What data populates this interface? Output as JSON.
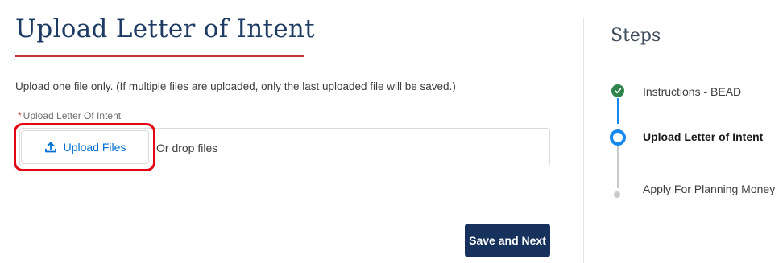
{
  "page": {
    "title": "Upload Letter of Intent",
    "instructions": "Upload one file only.  (If multiple files are uploaded, only the last uploaded file will be saved.)"
  },
  "upload_field": {
    "required_marker": "*",
    "label": "Upload Letter Of Intent",
    "button_label": "Upload Files",
    "drop_text": "Or drop files",
    "icon": "upload-icon"
  },
  "actions": {
    "save_next_label": "Save and Next"
  },
  "steps": {
    "title": "Steps",
    "items": [
      {
        "label": "Instructions - BEAD",
        "status": "complete"
      },
      {
        "label": "Upload Letter of Intent",
        "status": "current"
      },
      {
        "label": "Apply For Planning Money",
        "status": "pending"
      }
    ]
  },
  "colors": {
    "title": "#1d3b63",
    "title_underline": "#c23934",
    "link_blue": "#0070d2",
    "primary_button": "#16325c",
    "step_complete": "#2e844a",
    "step_active": "#1589ee",
    "highlight_annotation": "#e30613"
  }
}
